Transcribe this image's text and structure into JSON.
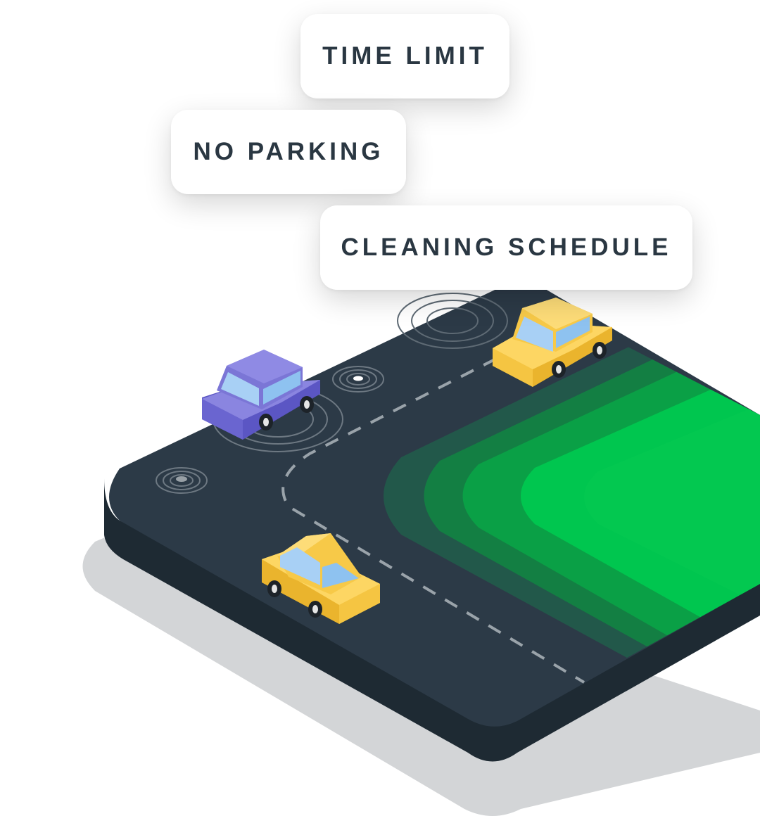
{
  "labels": {
    "time_limit": "TIME LIMIT",
    "no_parking": "NO PARKING",
    "cleaning_schedule": "CLEANING SCHEDULE"
  },
  "colors": {
    "road": "#2c3a47",
    "road_side": "#1e2a33",
    "shadow": "#d3d5d7",
    "park_green": "#00c64f",
    "yellow_car": "#fdd663",
    "purple_car": "#7b76d6",
    "label_text": "#2a3742"
  },
  "icons": [
    "yellow-car-icon",
    "purple-car-icon",
    "sensor-ripple-icon"
  ]
}
